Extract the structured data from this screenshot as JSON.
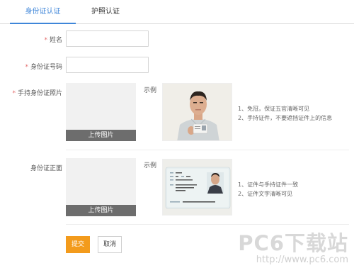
{
  "tabs": [
    {
      "label": "身份证认证",
      "active": true
    },
    {
      "label": "护照认证",
      "active": false
    }
  ],
  "form": {
    "required_mark": "*",
    "name_label": "姓名",
    "name_value": "",
    "id_number_label": "身份证号码",
    "id_number_value": "",
    "handheld_label": "手持身份证照片",
    "front_label": "身份证正面",
    "upload_label": "上传图片",
    "example_label": "示例"
  },
  "handheld_example": {
    "notes": [
      "1、免冠，保证五官清晰可见",
      "2、手持证件，不要遮挡证件上的信息"
    ]
  },
  "front_example": {
    "notes": [
      "1、证件与手持证件一致",
      "2、证件文字清晰可见"
    ]
  },
  "actions": {
    "submit_label": "提交",
    "cancel_label": "取消"
  },
  "watermark": {
    "logo": "PC6下载站",
    "url": "http://www.pc6.com"
  },
  "colors": {
    "accent_blue": "#3f86d9",
    "submit_orange": "#f39b1c",
    "required_red": "#e46b6b"
  }
}
